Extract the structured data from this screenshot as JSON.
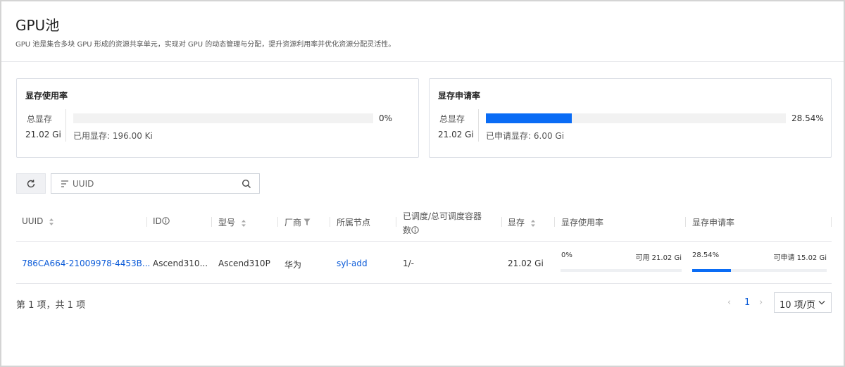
{
  "header": {
    "title": "GPU池",
    "description": "GPU 池是集合多块 GPU 形成的资源共享单元，实现对 GPU 的动态管理与分配，提升资源利用率并优化资源分配灵活性。"
  },
  "cards": [
    {
      "title": "显存使用率",
      "total_label": "总显存",
      "total_value": "21.02 Gi",
      "percent_text": "0%",
      "percent": 0,
      "sub_label": "已用显存:",
      "sub_value": "196.00 Ki"
    },
    {
      "title": "显存申请率",
      "total_label": "总显存",
      "total_value": "21.02 Gi",
      "percent_text": "28.54%",
      "percent": 28.54,
      "sub_label": "已申请显存:",
      "sub_value": "6.00 Gi"
    }
  ],
  "toolbar": {
    "refresh_icon": "refresh-icon",
    "search_placeholder": "UUID"
  },
  "table": {
    "columns": {
      "uuid": "UUID",
      "id": "ID",
      "model": "型号",
      "vendor": "厂商",
      "node": "所属节点",
      "scheduled_line1": "已调度/总可调度容器",
      "scheduled_line2": "数",
      "memory": "显存",
      "mem_usage": "显存使用率",
      "mem_request": "显存申请率"
    },
    "rows": [
      {
        "uuid": "786CA664-21009978-4453B...",
        "id": "Ascend310...",
        "model": "Ascend310P",
        "vendor": "华为",
        "node": "syl-add",
        "scheduled": "1/-",
        "memory": "21.02 Gi",
        "usage_pct_text": "0%",
        "usage_pct": 0,
        "usage_available": "可用 21.02 Gi",
        "request_pct_text": "28.54%",
        "request_pct": 28.54,
        "request_available": "可申请 15.02 Gi"
      }
    ]
  },
  "pagination": {
    "total_text": "第 1 项，共 1 项",
    "prev": "‹",
    "current_page": "1",
    "next": "›",
    "page_size": "10 项/页"
  },
  "colors": {
    "accent": "#0a6cf5",
    "link": "#0a5ad8"
  }
}
